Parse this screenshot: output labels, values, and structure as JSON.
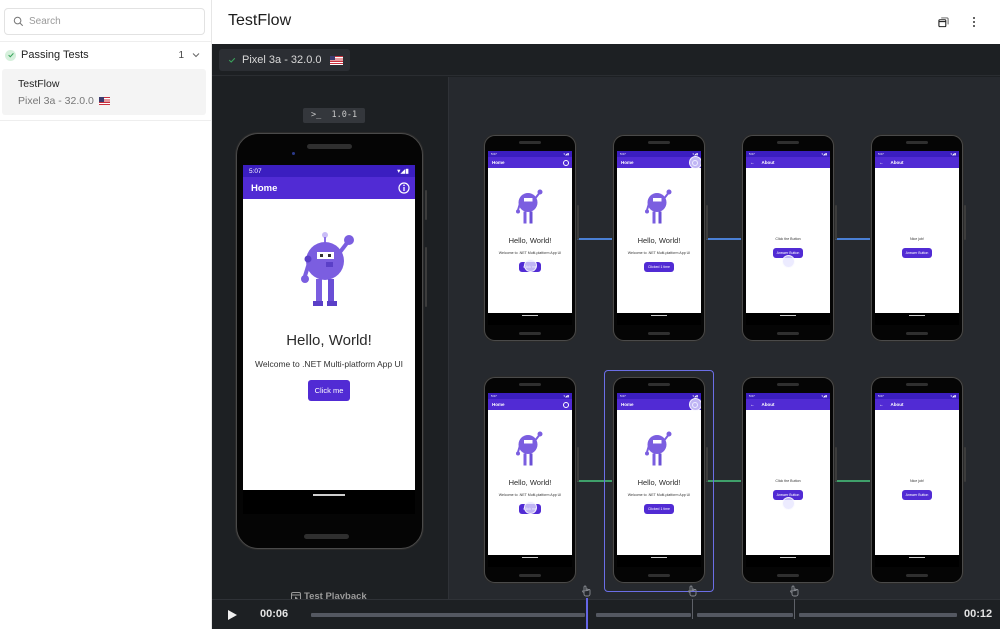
{
  "sidebar": {
    "search_placeholder": "Search",
    "search_value": "",
    "group": {
      "label": "Passing Tests",
      "count": "1",
      "status": "passed"
    },
    "tests": [
      {
        "name": "TestFlow",
        "device": "Pixel 3a - 32.0.0",
        "locale_flag": "us-flag"
      }
    ]
  },
  "header": {
    "title": "TestFlow",
    "actions": [
      "open-in-window-icon",
      "more-vert-icon"
    ]
  },
  "device_tab": {
    "label": "Pixel 3a - 32.0.0",
    "status": "passed",
    "locale_flag": "us-flag"
  },
  "version_badge": {
    "prompt": ">_",
    "value": "1.0-1"
  },
  "live_device": {
    "status_time": "5:07",
    "app_title": "Home",
    "hello": "Hello, World!",
    "welcome": "Welcome to .NET Multi-platform App UI",
    "button": "Click me"
  },
  "playback_label": "Test Playback",
  "flow": {
    "rows": [
      {
        "connector_color": "#4a7fd4",
        "steps": [
          {
            "screen": "Home",
            "app_title": "Home",
            "hello": "Hello, World!",
            "welcome": "Welcome to .NET Multi-platform App UI",
            "button": "Click me",
            "touch": "button"
          },
          {
            "screen": "Home",
            "app_title": "Home",
            "hello": "Hello, World!",
            "welcome": "Welcome to .NET Multi-platform App UI",
            "button": "Clicked 1 time",
            "touch": "info"
          },
          {
            "screen": "About",
            "app_title": "About",
            "message": "Click the Button",
            "button": "Answer Button",
            "touch": "button"
          },
          {
            "screen": "About",
            "app_title": "About",
            "message": "Nice job!",
            "button": "Answer Button",
            "touch": "none"
          }
        ]
      },
      {
        "connector_color": "#3f9f6a",
        "steps": [
          {
            "screen": "Home",
            "app_title": "Home",
            "hello": "Hello, World!",
            "welcome": "Welcome to .NET Multi-platform App UI",
            "button": "Click me",
            "touch": "button"
          },
          {
            "screen": "Home",
            "app_title": "Home",
            "hello": "Hello, World!",
            "welcome": "Welcome to .NET Multi-platform App UI",
            "button": "Clicked 1 time",
            "touch": "info",
            "selected": true
          },
          {
            "screen": "About",
            "app_title": "About",
            "message": "Click the Button",
            "button": "Answer Button",
            "touch": "button"
          },
          {
            "screen": "About",
            "app_title": "About",
            "message": "Nice job!",
            "button": "Answer Button",
            "touch": "none"
          }
        ]
      }
    ]
  },
  "timeline": {
    "current_time": "00:06",
    "total_time": "00:12",
    "progress": 0.5,
    "tap_markers": [
      "tap-icon",
      "tap-icon",
      "tap-icon"
    ]
  },
  "colors": {
    "accent": "#512bd4",
    "status_bar": "#3b1ec0",
    "playhead": "#6566e6",
    "pass_green": "#3aa55d"
  }
}
